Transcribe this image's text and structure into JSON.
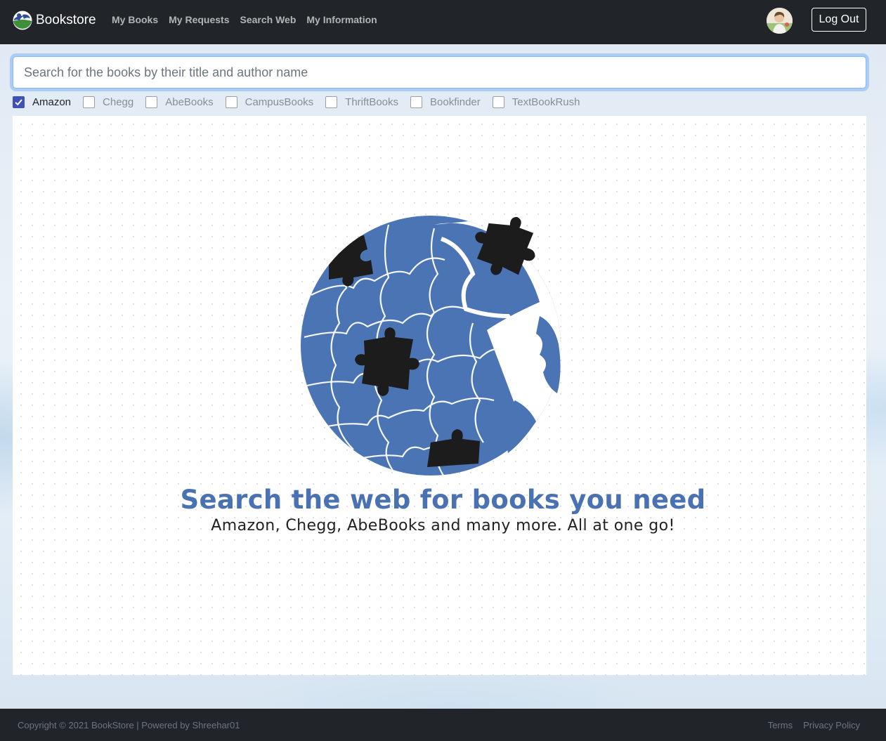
{
  "navbar": {
    "brand": "Bookstore",
    "links": [
      "My Books",
      "My Requests",
      "Search Web",
      "My Information"
    ],
    "logout_label": "Log Out"
  },
  "search": {
    "placeholder": "Search for the books by their title and author name",
    "value": ""
  },
  "sources": [
    {
      "label": "Amazon",
      "checked": true
    },
    {
      "label": "Chegg",
      "checked": false
    },
    {
      "label": "AbeBooks",
      "checked": false
    },
    {
      "label": "CampusBooks",
      "checked": false
    },
    {
      "label": "ThriftBooks",
      "checked": false
    },
    {
      "label": "Bookfinder",
      "checked": false
    },
    {
      "label": "TextBookRush",
      "checked": false
    }
  ],
  "hero": {
    "headline": "Search the web for books you need",
    "subline": "Amazon, Chegg, AbeBooks and many more. All at one go!"
  },
  "footer": {
    "copyright": "Copyright © 2021 BookStore | Powered by Shreehar01",
    "links": [
      "Terms",
      "Privacy Policy"
    ]
  },
  "colors": {
    "navbar_bg": "#212529",
    "accent_blue": "#4a72b2",
    "checkbox_checked": "#3f51b5"
  }
}
